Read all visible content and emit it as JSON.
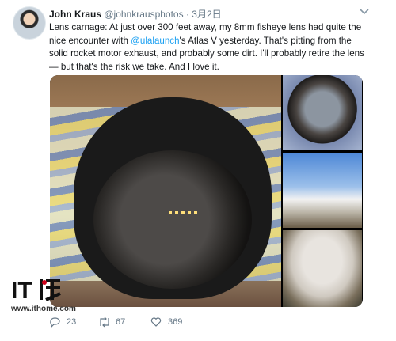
{
  "tweet": {
    "display_name": "John Kraus",
    "handle": "@johnkrausphotos",
    "separator": "·",
    "date": "3月2日",
    "text_before_mention": "Lens carnage: At just over 300 feet away, my 8mm fisheye lens had quite the nice encounter with ",
    "mention": "@ulalaunch",
    "text_after_mention": "'s Atlas V yesterday. That's pitting from the solid rocket motor exhaust, and probably some dirt. I'll probably retire the lens — but that's the risk we take. And I love it."
  },
  "actions": {
    "replies": "23",
    "retweets": "67",
    "likes": "369"
  },
  "watermark": {
    "logo_text": "IT之家",
    "url": "www.ithome.com"
  },
  "colors": {
    "link": "#1da1f2",
    "secondary_text": "#657786",
    "primary_text": "#14171a"
  }
}
